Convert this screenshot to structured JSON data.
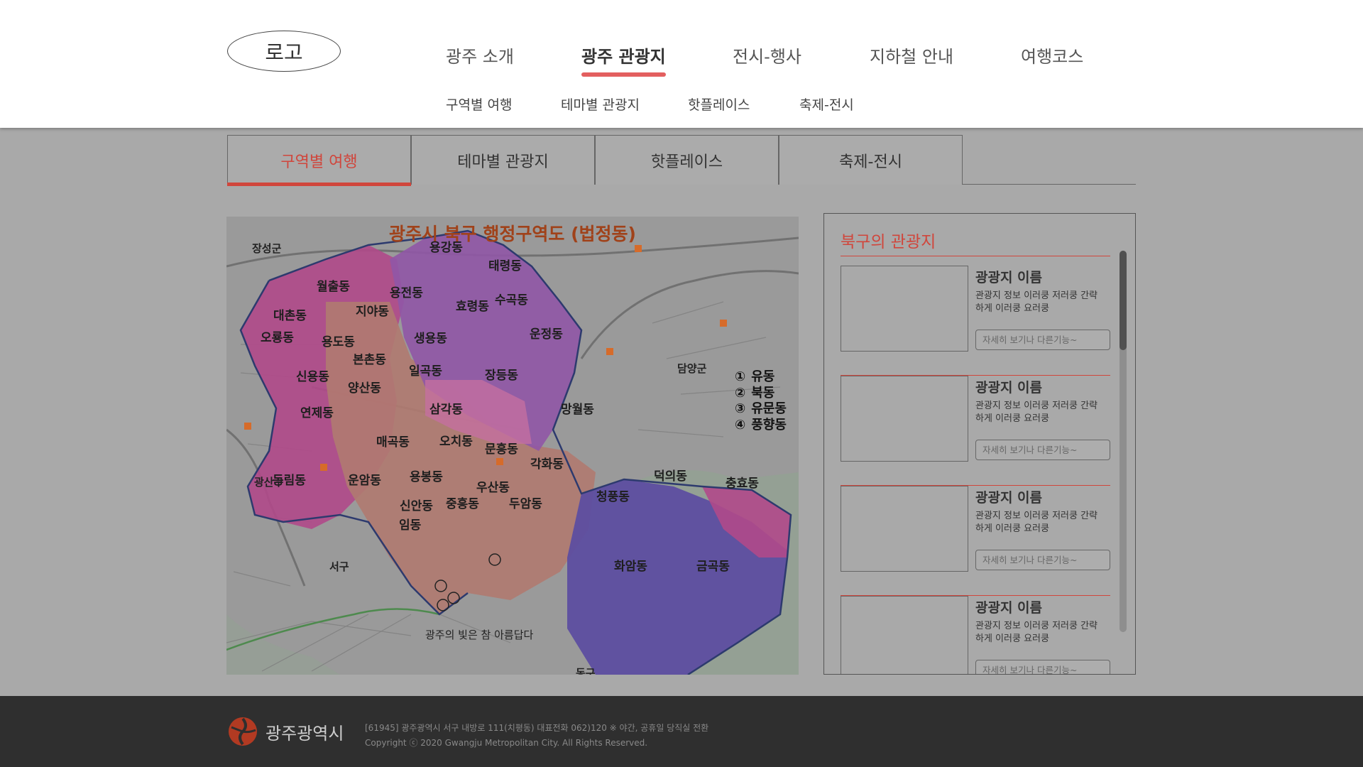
{
  "header": {
    "logo": "로고",
    "main_nav": [
      "광주 소개",
      "광주 관광지",
      "전시-행사",
      "지하철 안내",
      "여행코스"
    ],
    "sub_nav": [
      "구역별 여행",
      "테마별 관광지",
      "핫플레이스",
      "축제-전시"
    ]
  },
  "tabs": [
    "구역별 여행",
    "테마별 관광지",
    "핫플레이스",
    "축제-전시"
  ],
  "map": {
    "title": "광주시 북구 행정구역도 (법정동)",
    "areas": [
      "장성군",
      "담양군",
      "광산구",
      "서구",
      "동구"
    ],
    "dongs": [
      "용강동",
      "태령동",
      "월출동",
      "용전동",
      "수곡동",
      "대촌동",
      "지야동",
      "효령동",
      "오룡동",
      "용도동",
      "생용동",
      "운정동",
      "본촌동",
      "일곡동",
      "신용동",
      "양산동",
      "장등동",
      "연제동",
      "삼각동",
      "망월동",
      "매곡동",
      "오치동",
      "문흥동",
      "각화동",
      "동림동",
      "운암동",
      "용봉동",
      "우산동",
      "덕의동",
      "충효동",
      "청풍동",
      "신안동",
      "중흥동",
      "두암동",
      "임동",
      "화암동",
      "금곡동"
    ],
    "legend": [
      {
        "num": "①",
        "name": "유동"
      },
      {
        "num": "②",
        "name": "북동"
      },
      {
        "num": "③",
        "name": "유문동"
      },
      {
        "num": "④",
        "name": "풍향동"
      }
    ],
    "slogan": "광주의 빛은 참 아름답다"
  },
  "panel": {
    "title": "북구의 관광지",
    "cards": [
      {
        "name": "광광지 이름",
        "desc": "관광지 정보 이러쿵 저러쿵 간략하게 이러쿵 요러쿵",
        "more": "자세히 보기나 다른기능~"
      },
      {
        "name": "광광지 이름",
        "desc": "관광지 정보 이러쿵 저러쿵 간략하게 이러쿵 요러쿵",
        "more": "자세히 보기나 다른기능~"
      },
      {
        "name": "광광지 이름",
        "desc": "관광지 정보 이러쿵 저러쿵 간략하게 이러쿵 요러쿵",
        "more": "자세히 보기나 다른기능~"
      },
      {
        "name": "광광지 이름",
        "desc": "관광지 정보 이러쿵 저러쿵 간략하게 이러쿵 요러쿵",
        "more": "자세히 보기나 다른기능~"
      }
    ]
  },
  "footer": {
    "brand": "광주광역시",
    "address": "[61945] 광주광역시 서구 내방로 111(치평동) 대표전화 062)120 ※ 야간, 공휴일 당직실 전환",
    "copyright": "Copyright ⓒ 2020 Gwangju Metropolitan City. All Rights Reserved."
  },
  "colors": {
    "accent": "#d0463c",
    "overlay": "#a9a9a9",
    "footer_bg": "#2f2f2f",
    "map_title": "#a0421a"
  }
}
